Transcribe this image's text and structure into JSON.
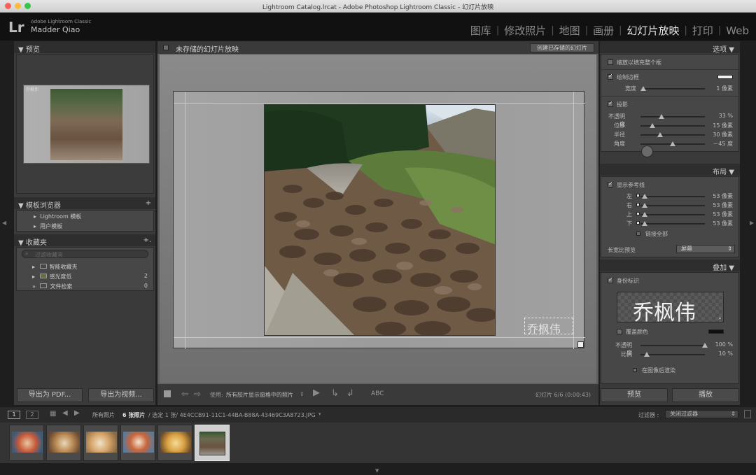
{
  "window": {
    "title": "Lightroom Catalog.lrcat - Adobe Photoshop Lightroom Classic - 幻灯片放映"
  },
  "identity": {
    "app": "Adobe Lightroom Classic",
    "user": "Madder Qiao",
    "logo": "Lr"
  },
  "modules": [
    {
      "label": "图库",
      "active": false
    },
    {
      "label": "修改照片",
      "active": false
    },
    {
      "label": "地图",
      "active": false
    },
    {
      "label": "画册",
      "active": false
    },
    {
      "label": "幻灯片放映",
      "active": true
    },
    {
      "label": "打印",
      "active": false
    },
    {
      "label": "Web",
      "active": false
    }
  ],
  "left": {
    "preview_header": "预览",
    "preview_watermark": "乔枫伟",
    "template_header": "模板浏览器",
    "templates": [
      "Lightroom 模板",
      "用户模板"
    ],
    "collections_header": "收藏夹",
    "filter_placeholder": "过滤收藏夹",
    "collections": [
      {
        "label": "智能收藏夹",
        "count": ""
      },
      {
        "label": "感光度低",
        "count": "2"
      },
      {
        "label": "文件检索",
        "count": "0"
      }
    ],
    "export_pdf": "导出为 PDF...",
    "export_video": "导出为视频..."
  },
  "center": {
    "header": "未存储的幻灯片放映",
    "create_btn": "创建已存储的幻灯片",
    "watermark": "乔枫伟",
    "toolbar": {
      "use_label": "使用:",
      "use_value": "所有胶片显示窗格中的照片",
      "abc": "ABC",
      "slide_info": "幻灯片 6/6 (0:00:43)"
    }
  },
  "right": {
    "options_header": "选项",
    "zoom_fill": "缩放以填充整个框",
    "stroke_border": "绘制边框",
    "width_label": "宽度",
    "width_value": "1 像素",
    "width_level": 0.02,
    "shadow": "投影",
    "shadow_rows": [
      {
        "label": "不透明度",
        "value": "33 %",
        "level": 0.33
      },
      {
        "label": "位移",
        "value": "15 像素",
        "level": 0.18
      },
      {
        "label": "半径",
        "value": "30 像素",
        "level": 0.3
      },
      {
        "label": "角度",
        "value": "－45 度",
        "level": 0.5
      }
    ],
    "layout_header": "布局",
    "show_guides": "显示参考线",
    "guide_rows": [
      {
        "label": "左",
        "value": "53 像素",
        "level": 0.06
      },
      {
        "label": "右",
        "value": "53 像素",
        "level": 0.06
      },
      {
        "label": "上",
        "value": "53 像素",
        "level": 0.06
      },
      {
        "label": "下",
        "value": "53 像素",
        "level": 0.06
      }
    ],
    "link_all": "链接全部",
    "aspect_label": "长宽比预览",
    "aspect_value": "屏幕",
    "overlay_header": "叠加",
    "identity_plate": "身份标识",
    "plate_text": "乔枫伟",
    "override_color": "覆盖颜色",
    "overlay_rows": [
      {
        "label": "不透明度",
        "value": "100 %",
        "level": 1.0
      },
      {
        "label": "比例",
        "value": "10 %",
        "level": 0.1
      }
    ],
    "render_behind": "在图像后渲染",
    "preview_btn": "预览",
    "play_btn": "播放"
  },
  "filmstrip": {
    "page1": "1",
    "page2": "2",
    "source": "所有照片",
    "count": "6 张照片",
    "selection": "/ 选定 1 张/ 4E4CCB91-11C1-44BA-B88A-43469C3A8723.JPG",
    "filter_label": "过滤器 :",
    "filter_value": "关闭过滤器"
  },
  "colors": {
    "accent": "#e6e6e6",
    "panel": "#3a3a3a",
    "panel_body": "#474747"
  }
}
